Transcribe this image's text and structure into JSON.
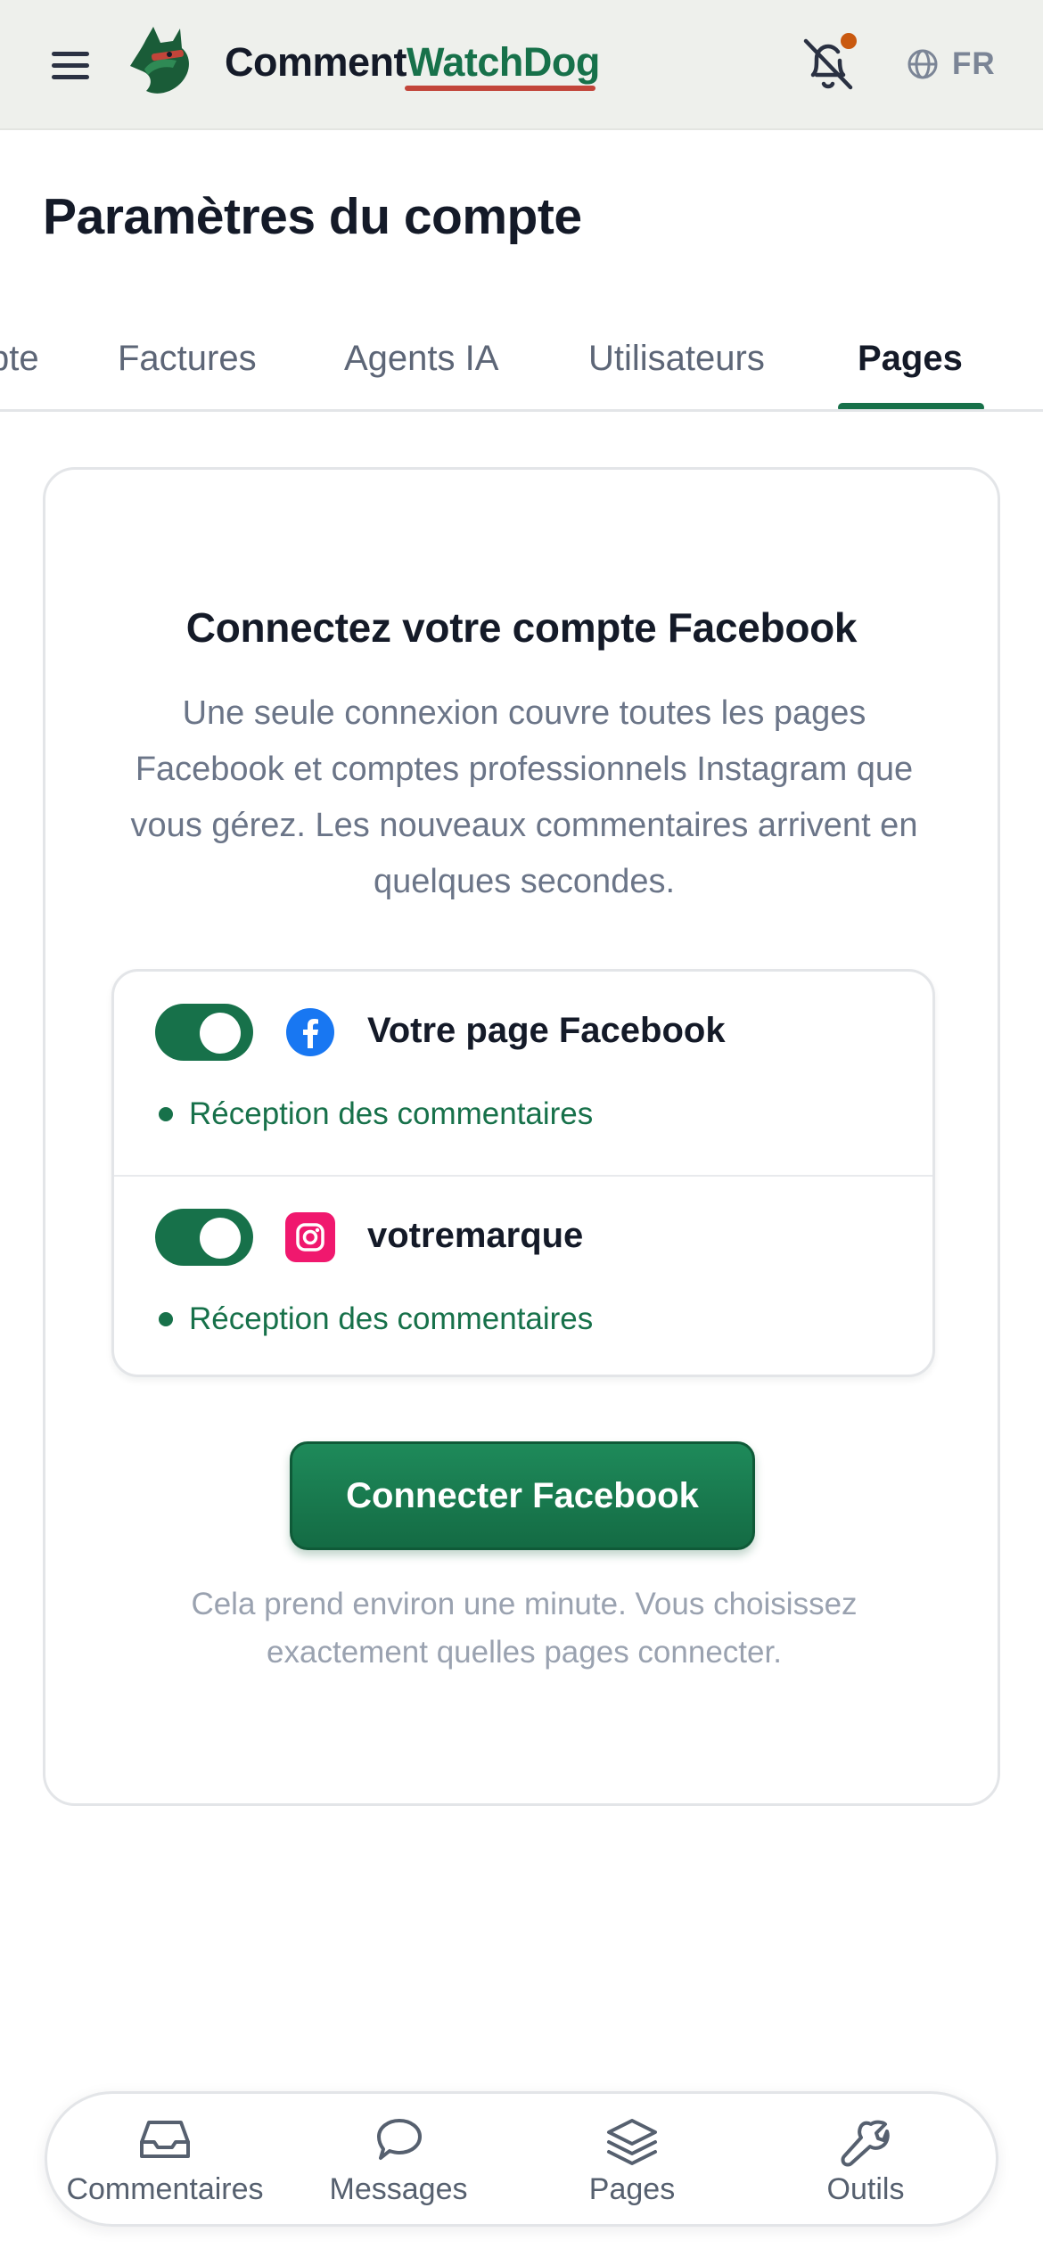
{
  "header": {
    "brand_part1": "Comment",
    "brand_part2": "WatchDog",
    "language": "FR",
    "icons": [
      "menu-icon",
      "watchdog-logo",
      "bell-off-icon",
      "globe-icon"
    ]
  },
  "page": {
    "title": "Paramètres du compte"
  },
  "tabs": [
    {
      "label": "pte",
      "active": false
    },
    {
      "label": "Factures",
      "active": false
    },
    {
      "label": "Agents IA",
      "active": false
    },
    {
      "label": "Utilisateurs",
      "active": false
    },
    {
      "label": "Pages",
      "active": true
    }
  ],
  "card": {
    "title": "Connectez votre compte Facebook",
    "description": "Une seule connexion couvre toutes les pages Facebook et comptes professionnels Instagram que vous gérez. Les nouveaux commentaires arrivent en quelques secondes.",
    "accounts": [
      {
        "name": "Votre page Facebook",
        "platform": "facebook",
        "enabled": true,
        "status": "Réception des commentaires"
      },
      {
        "name": "votremarque",
        "platform": "instagram",
        "enabled": true,
        "status": "Réception des commentaires"
      }
    ],
    "cta_label": "Connecter Facebook",
    "note": "Cela prend environ une minute. Vous choisissez exactement quelles pages connecter."
  },
  "bottom_nav": [
    {
      "label": "Commentaires",
      "icon": "inbox-icon"
    },
    {
      "label": "Messages",
      "icon": "message-circle-icon"
    },
    {
      "label": "Pages",
      "icon": "layers-icon"
    },
    {
      "label": "Outils",
      "icon": "wrench-icon"
    }
  ],
  "colors": {
    "accent": "#17714a",
    "header_bg": "#eef0ec",
    "notification_dot": "#c9590f",
    "brand_underline": "#c2453a",
    "facebook": "#1877f2",
    "instagram": "#f0186e"
  }
}
